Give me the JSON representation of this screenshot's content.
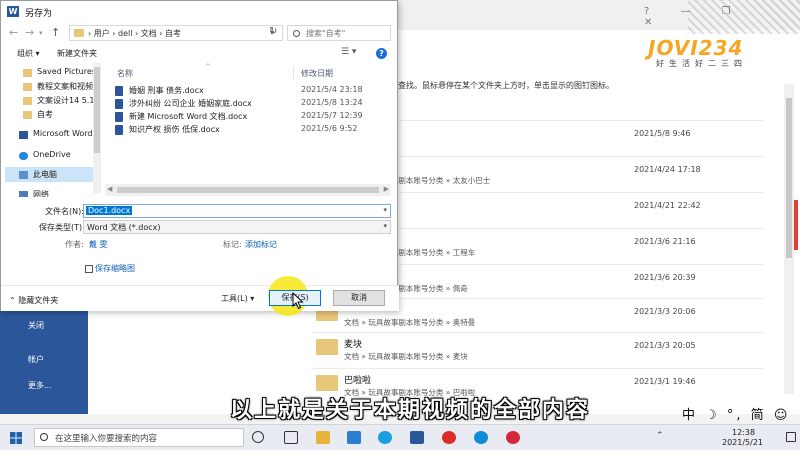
{
  "dialog": {
    "title": "另存为",
    "address": "› 用户 › dell › 文档 › 自考",
    "search_placeholder": "搜索\"自考\"",
    "toolbar": {
      "organize": "组织 ▾",
      "new_folder": "新建文件夹"
    },
    "nav_items": [
      {
        "label": "Saved Pictures",
        "icon": "folder-icon"
      },
      {
        "label": "教程文案和视频",
        "icon": "folder-icon"
      },
      {
        "label": "文案设计14 5.19",
        "icon": "folder-icon"
      },
      {
        "label": "自考",
        "icon": "folder-icon"
      },
      {
        "label": "Microsoft Word",
        "icon": "word-icon"
      },
      {
        "label": "OneDrive",
        "icon": "cloud-icon"
      },
      {
        "label": "此电脑",
        "icon": "computer-icon"
      },
      {
        "label": "网络",
        "icon": "network-icon"
      }
    ],
    "columns": {
      "name": "名称",
      "date": "修改日期"
    },
    "files": [
      {
        "name": "婚姻 刑事 债务.docx",
        "date": "2021/5/4 23:18"
      },
      {
        "name": "涉外纠纷 公司企业 婚姻家庭.docx",
        "date": "2021/5/8 13:24"
      },
      {
        "name": "新建 Microsoft Word 文档.docx",
        "date": "2021/5/7 12:39"
      },
      {
        "name": "知识产权 损伤 低保.docx",
        "date": "2021/5/6 9:52"
      }
    ],
    "filename_label": "文件名(N):",
    "filename_value": "Doc1.docx",
    "filetype_label": "保存类型(T):",
    "filetype_value": "Word 文档 (*.docx)",
    "author_label": "作者:",
    "author_value": "戴 雯",
    "tags_label": "标记:",
    "tags_value": "添加标记",
    "thumbnail_label": "保存缩略图",
    "hide_folders": "隐藏文件夹",
    "tools_label": "工具(L)",
    "save_label": "保存(S)",
    "cancel_label": "取消"
  },
  "word": {
    "left_items": [
      "关闭",
      "帐户",
      "更多..."
    ],
    "hint": "查找。鼠标悬停在某个文件夹上方时，单击显示的图钉图标。",
    "recent": [
      {
        "title": "",
        "path": "",
        "date": "2021/5/8 9:46"
      },
      {
        "title": "",
        "path": "文档 » 玩具故事剧本账号分类 » 太友小巴士",
        "date": "2021/4/24 17:18"
      },
      {
        "title": "",
        "path": "",
        "date": "2021/4/21 22:42"
      },
      {
        "title": "",
        "path": "文档 » 玩具故事剧本账号分类 » 工程车",
        "date": "2021/3/6 21:16"
      },
      {
        "title": "",
        "path": "文档 » 玩具故事剧本账号分类 » 佩奇",
        "date": "2021/3/6 20:39"
      },
      {
        "title": "",
        "path": "文档 » 玩具故事剧本账号分类 » 奥特曼",
        "date": "2021/3/3 20:06"
      },
      {
        "title": "麦块",
        "path": "文档 » 玩具故事剧本账号分类 » 麦块",
        "date": "2021/3/3 20:05"
      },
      {
        "title": "巴啦啦",
        "path": "文档 » 玩具故事剧本账号分类 » 巴啦啦",
        "date": "2021/3/1 19:46"
      }
    ]
  },
  "logo": {
    "text": "JOVI234",
    "sub": "好生活好二三四"
  },
  "subtitle": "以上就是关于本期视频的全部内容",
  "ime": "中 ☽ °, 简 ☺ ⚙",
  "taskbar": {
    "search_placeholder": "在这里输入你要搜索的内容",
    "time": "12:38",
    "date": "2021/5/21"
  },
  "colors": {
    "word_blue": "#2b579a",
    "highlight": "#f5e614",
    "accent": "#0078d7"
  }
}
